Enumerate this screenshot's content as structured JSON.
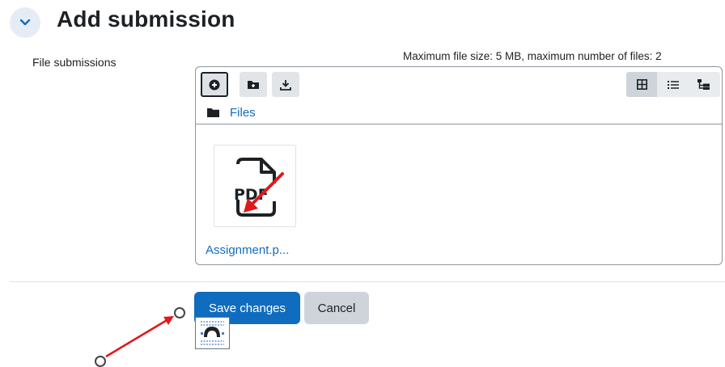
{
  "header": {
    "title": "Add submission",
    "collapse_icon": "chevron-down-icon"
  },
  "form": {
    "field_label": "File submissions",
    "limits_text": "Maximum file size: 5 MB, maximum number of files: 2"
  },
  "filemanager": {
    "toolbar": {
      "add_icon": "plus-circle-icon",
      "new_folder_icon": "folder-plus-icon",
      "download_icon": "download-icon",
      "views": [
        "grid-view-icon",
        "list-view-icon",
        "tree-view-icon"
      ],
      "active_view": "grid-view-icon"
    },
    "breadcrumb": {
      "icon": "folder-icon",
      "label": "Files"
    },
    "files": [
      {
        "icon": "pdf-file-icon",
        "name": "Assignment.p..."
      }
    ]
  },
  "actions": {
    "save_label": "Save changes",
    "cancel_label": "Cancel"
  },
  "colors": {
    "primary": "#0f6cbf",
    "secondary_button": "#ced4da",
    "annotation_arrow": "#e0191b"
  }
}
